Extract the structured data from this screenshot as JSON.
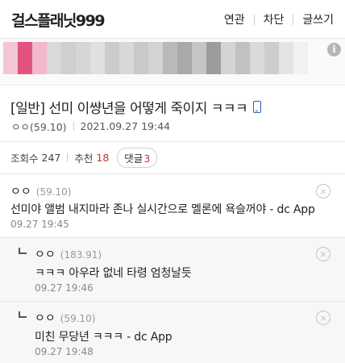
{
  "header": {
    "site_title": "걸스플래닛999",
    "nav": [
      "연관",
      "차단",
      "글쓰기"
    ]
  },
  "ad": {
    "info_icon": "info-icon",
    "info_glyph": "i",
    "blur_colors": [
      "#f3c6d6",
      "#e2537f",
      "#f4b8cb",
      "#d9d9d9",
      "#cfcfcf",
      "#d6d6d6",
      "#e0e0e0",
      "#cbcbcb",
      "#d8d8d8",
      "#c9c9c9",
      "#d3d3d3",
      "#b9b9b9",
      "#a9a9a9",
      "#c5c5c5",
      "#9c9c9c",
      "#d4d4d4",
      "#c1c1c1",
      "#dadada",
      "#cdcdcd",
      "#e4e4e4",
      "#f1f1f1"
    ]
  },
  "post": {
    "title": "[일반] 선미 이썅년을 어떻게 죽이지 ㅋㅋㅋ",
    "device_icon": "mobile-icon",
    "author": "ㅇㅇ(59.10)",
    "datetime": "2021.09.27 19:44"
  },
  "stats": {
    "views_label": "조회수",
    "views": "247",
    "recommend_label": "추천",
    "recommend": "18",
    "comment_label": "댓글",
    "comment_count": "3"
  },
  "comments": [
    {
      "author": "ㅇㅇ",
      "score": "(59.10)",
      "text": "선미야 앨범 내지마라 존나 실시간으로 멜론에 욕슬꺼야 - dc App",
      "time": "09.27 19:45"
    },
    {
      "author": "ㅇㅇ",
      "score": "(183.91)",
      "text": "ㅋㅋㅋ 아우라 없네 타령 엄청날듯",
      "time": "09.27 19:46"
    },
    {
      "author": "ㅇㅇ",
      "score": "(59.10)",
      "text": "미친 무당년 ㅋㅋㅋ - dc App",
      "time": "09.27 19:48"
    }
  ],
  "colors": {
    "accent_red": "#c53030",
    "mobile_icon_blue": "#2c5fb8",
    "reply_bg": "#f7f7f7"
  }
}
